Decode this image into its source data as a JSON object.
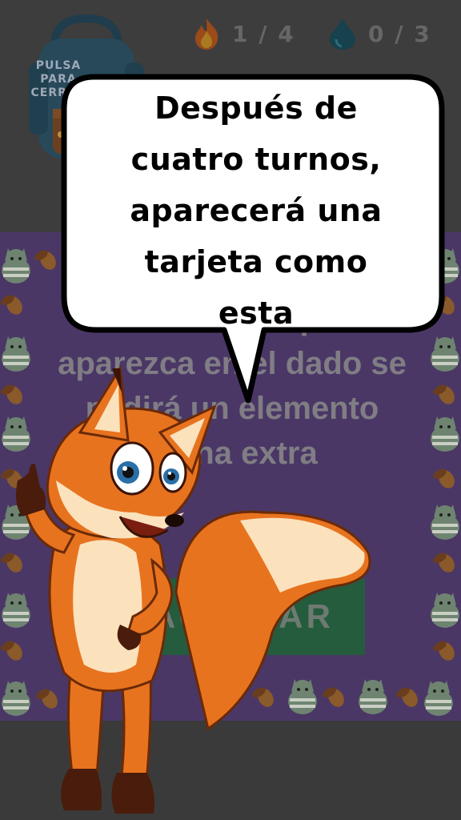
{
  "hud": {
    "backpack_label": "PULSA PARA CERRAR",
    "backpack_lines": [
      "PULSA",
      "PARA",
      "CERRAR"
    ],
    "fire": {
      "icon": "fire-icon",
      "value": "1 / 4"
    },
    "water": {
      "icon": "water-drop-icon",
      "value": "0 / 3"
    }
  },
  "card": {
    "text": "Por cada 3 que aparezca en el dado se pedirá un elemento arena extra",
    "button_label": "ACEPTAR",
    "background": "#4a3766",
    "button_color": "#255c3d",
    "pattern_icons": [
      "cat-icon",
      "acorn-icon"
    ]
  },
  "tutorial": {
    "bubble_text": "Después de cuatro turnos, aparecerá una tarjeta como esta",
    "bubble_lines": [
      "Después de",
      "cuatro turnos,",
      "aparecerá una",
      "tarjeta como",
      "esta"
    ],
    "character": "fox-character"
  }
}
